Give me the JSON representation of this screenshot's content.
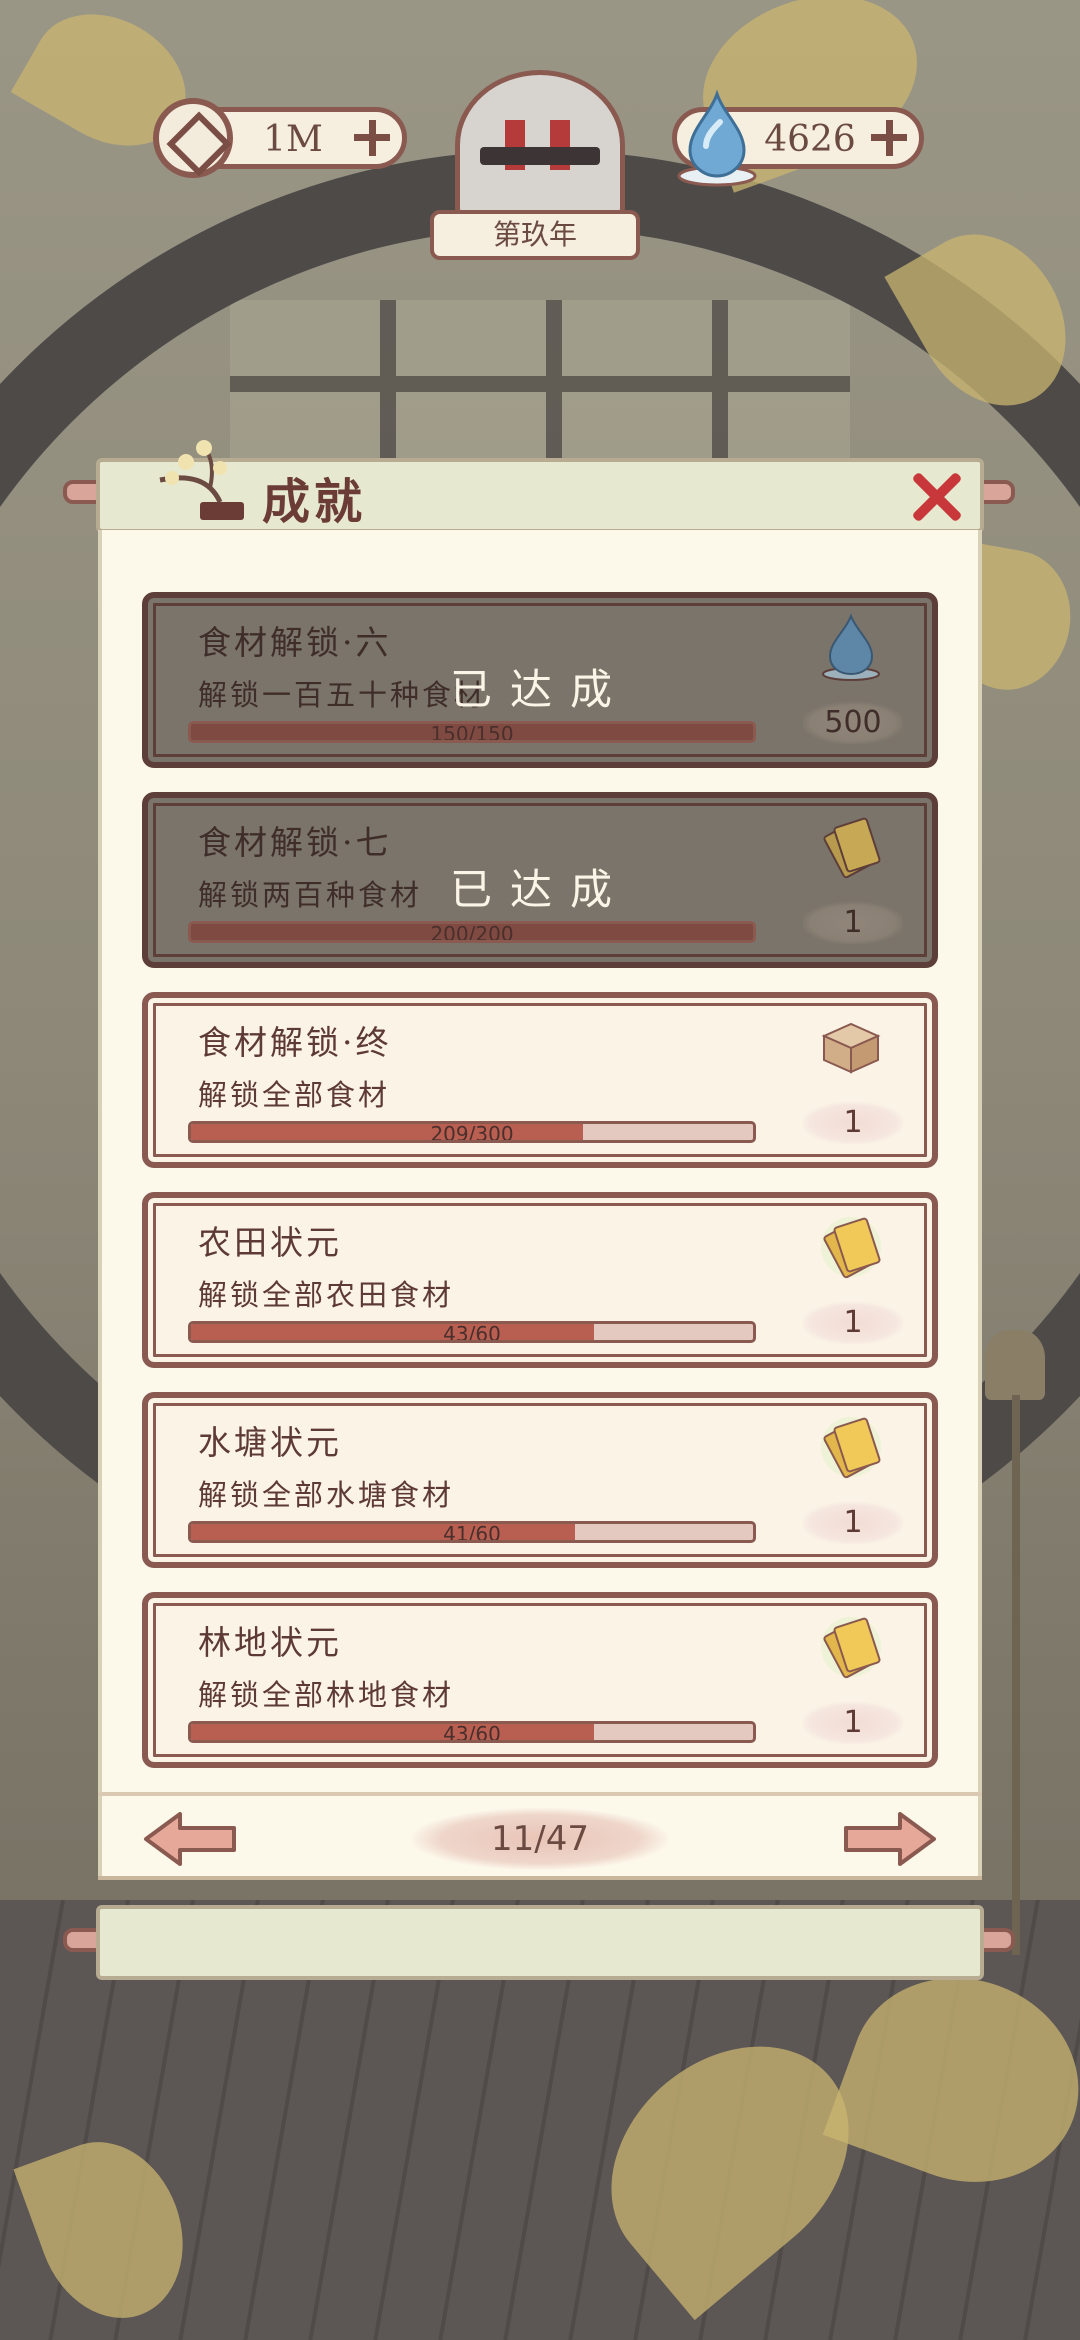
{
  "hud": {
    "coins": "1M",
    "water": "4626",
    "year": "第玖年"
  },
  "panel": {
    "title": "成就"
  },
  "done_label": "已达成",
  "achievements": [
    {
      "name": "食材解锁·六",
      "desc": "解锁一百五十种食材",
      "current": 150,
      "total": 150,
      "progress": "150/150",
      "reward_icon": "water-drop-icon",
      "reward_qty": "500",
      "completed": true
    },
    {
      "name": "食材解锁·七",
      "desc": "解锁两百种食材",
      "current": 200,
      "total": 200,
      "progress": "200/200",
      "reward_icon": "ticket-icon",
      "reward_qty": "1",
      "completed": true
    },
    {
      "name": "食材解锁·终",
      "desc": "解锁全部食材",
      "current": 209,
      "total": 300,
      "progress": "209/300",
      "reward_icon": "wooden-box-icon",
      "reward_qty": "1",
      "completed": false
    },
    {
      "name": "农田状元",
      "desc": "解锁全部农田食材",
      "current": 43,
      "total": 60,
      "progress": "43/60",
      "reward_icon": "ticket-icon",
      "reward_qty": "1",
      "completed": false
    },
    {
      "name": "水塘状元",
      "desc": "解锁全部水塘食材",
      "current": 41,
      "total": 60,
      "progress": "41/60",
      "reward_icon": "ticket-icon",
      "reward_qty": "1",
      "completed": false
    },
    {
      "name": "林地状元",
      "desc": "解锁全部林地食材",
      "current": 43,
      "total": 60,
      "progress": "43/60",
      "reward_icon": "ticket-icon",
      "reward_qty": "1",
      "completed": false
    }
  ],
  "pager": {
    "label": "11/47"
  },
  "colors": {
    "accent_red": "#c8383a",
    "border_brown": "#8a5a50",
    "progress_fill": "#b85f52",
    "panel_bg": "#fcf8ea"
  }
}
